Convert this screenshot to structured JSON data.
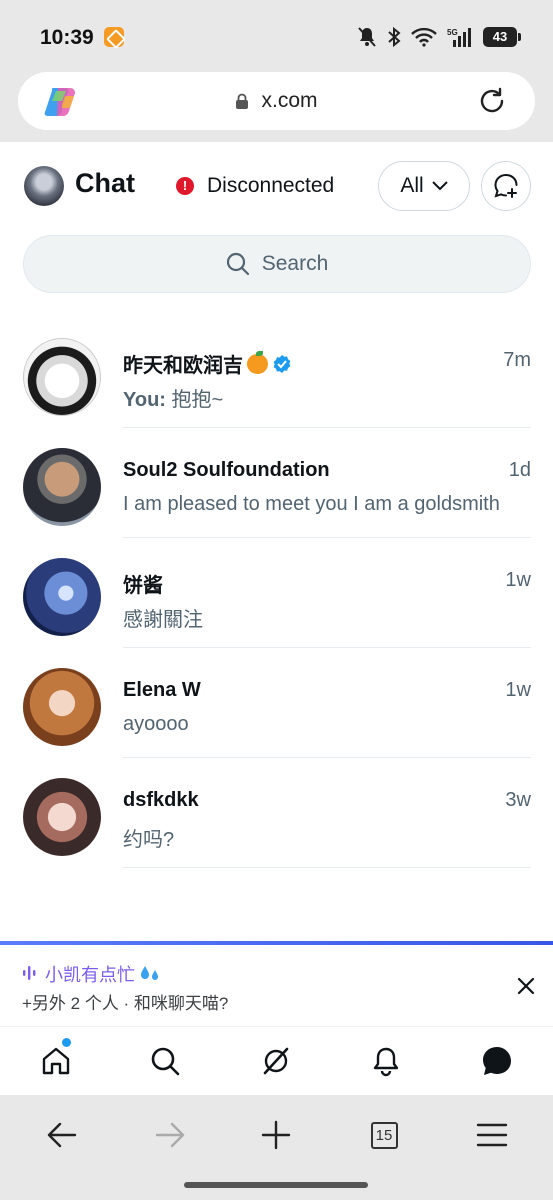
{
  "status_bar": {
    "time": "10:39",
    "battery": "43",
    "network": "5G"
  },
  "browser": {
    "url": "x.com"
  },
  "header": {
    "title": "Chat",
    "connection_status": "Disconnected",
    "filter_label": "All"
  },
  "search": {
    "placeholder": "Search"
  },
  "conversations": [
    {
      "name": "昨天和欧润吉",
      "verified": true,
      "time": "7m",
      "preview_prefix": "You:",
      "preview": "抱抱~"
    },
    {
      "name": "Soul2 Soulfoundation",
      "verified": false,
      "time": "1d",
      "preview_prefix": "",
      "preview": "I am pleased to meet you I am  a goldsmith"
    },
    {
      "name": "饼酱",
      "verified": false,
      "time": "1w",
      "preview_prefix": "",
      "preview": "感謝關注"
    },
    {
      "name": "Elena W",
      "verified": false,
      "time": "1w",
      "preview_prefix": "",
      "preview": "ayoooo"
    },
    {
      "name": "dsfkdkk",
      "verified": false,
      "time": "3w",
      "preview_prefix": "",
      "preview": "约吗?"
    }
  ],
  "banner": {
    "title": "小凯有点忙",
    "subtitle": "+另外 2 个人 · 和咪聊天喵?"
  },
  "tabs": [
    {
      "icon": "home-icon",
      "has_notification_dot": true
    },
    {
      "icon": "search-icon"
    },
    {
      "icon": "grok-icon"
    },
    {
      "icon": "bell-icon"
    },
    {
      "icon": "messages-icon",
      "active": true
    }
  ],
  "browser_nav": {
    "tab_count": "15"
  },
  "colors": {
    "accent": "#1d9bf0",
    "error": "#e0182b",
    "banner_purple": "#7b5cf0"
  }
}
